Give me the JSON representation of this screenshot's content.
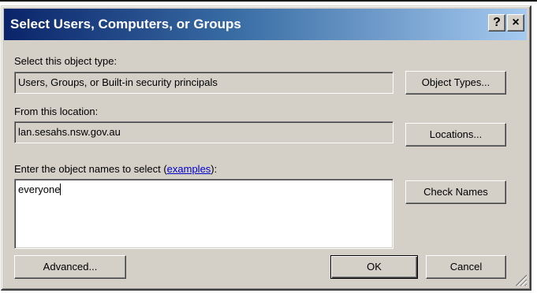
{
  "window": {
    "title": "Select Users, Computers, or Groups",
    "help_label": "?",
    "close_label": "×"
  },
  "object_type": {
    "label": "Select this object type:",
    "value": "Users, Groups, or Built-in security principals",
    "button_label": "Object Types..."
  },
  "location": {
    "label": "From this location:",
    "value": "lan.sesahs.nsw.gov.au",
    "button_label": "Locations..."
  },
  "object_names": {
    "label_prefix": "Enter the object names to select (",
    "link_text": "examples",
    "label_suffix": "):",
    "value": "everyone",
    "button_label": "Check Names"
  },
  "footer": {
    "advanced_label": "Advanced...",
    "ok_label": "OK",
    "cancel_label": "Cancel"
  },
  "colors": {
    "title_gradient_start": "#0a246a",
    "title_gradient_end": "#a6caf0",
    "dialog_background": "#d4d0c8",
    "link": "#0000cc"
  }
}
